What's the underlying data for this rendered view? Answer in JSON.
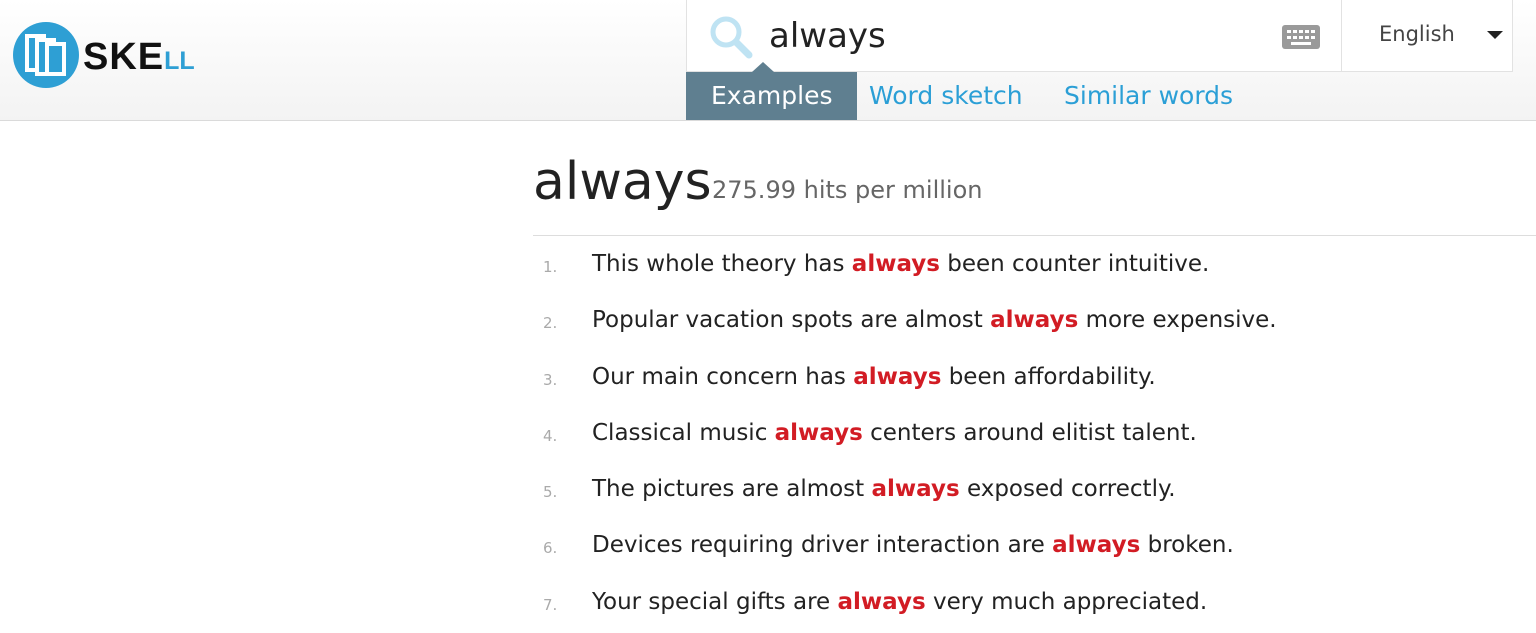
{
  "logo": {
    "text_main": "SKE",
    "text_accent": "LL"
  },
  "search": {
    "query": "always",
    "placeholder": ""
  },
  "language": {
    "selected": "English"
  },
  "tabs": [
    {
      "label": "Examples",
      "active": true
    },
    {
      "label": "Word sketch",
      "active": false
    },
    {
      "label": "Similar words",
      "active": false
    }
  ],
  "result": {
    "headword": "always",
    "hits": "275.99 hits per million"
  },
  "examples": [
    {
      "num": "1.",
      "before": "This whole theory has ",
      "keyword": "always",
      "after": " been counter intuitive."
    },
    {
      "num": "2.",
      "before": "Popular vacation spots are almost ",
      "keyword": "always",
      "after": " more expensive."
    },
    {
      "num": "3.",
      "before": "Our main concern has ",
      "keyword": "always",
      "after": " been affordability."
    },
    {
      "num": "4.",
      "before": "Classical music ",
      "keyword": "always",
      "after": " centers around elitist talent."
    },
    {
      "num": "5.",
      "before": "The pictures are almost ",
      "keyword": "always",
      "after": " exposed correctly."
    },
    {
      "num": "6.",
      "before": "Devices requiring driver interaction are ",
      "keyword": "always",
      "after": " broken."
    },
    {
      "num": "7.",
      "before": "Your special gifts are ",
      "keyword": "always",
      "after": " very much appreciated."
    }
  ],
  "colors": {
    "brand_blue": "#2e9fd4",
    "active_tab": "#5f7f90",
    "keyword_red": "#d21c24",
    "link_blue": "#2b9fd6"
  }
}
